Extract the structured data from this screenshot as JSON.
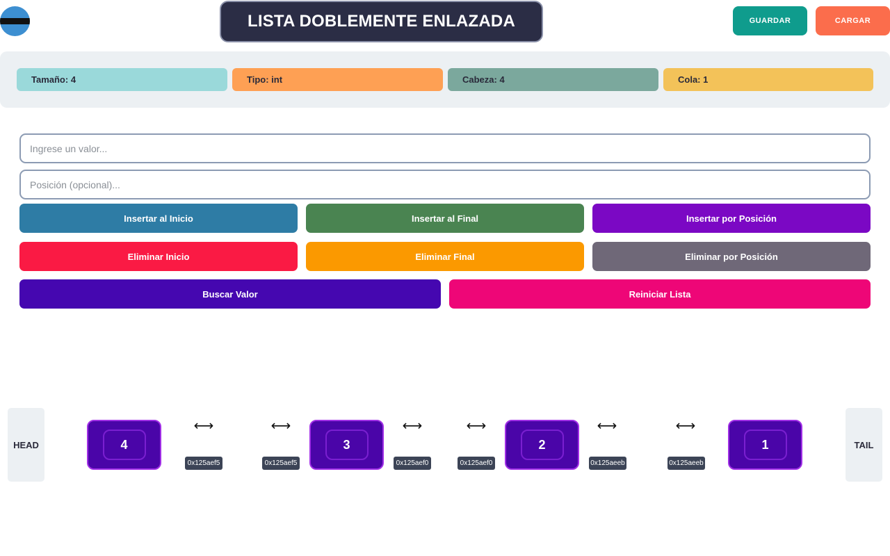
{
  "header": {
    "title": "LISTA DOBLEMENTE ENLAZADA",
    "save_label": "GUARDAR",
    "load_label": "CARGAR"
  },
  "stats": [
    {
      "label": "Tamaño: 4",
      "color": "#9ad9da"
    },
    {
      "label": "Tipo: int",
      "color": "#fea054"
    },
    {
      "label": "Cabeza: 4",
      "color": "#7ba89d"
    },
    {
      "label": "Cola: 1",
      "color": "#f3c259"
    }
  ],
  "inputs": {
    "value_placeholder": "Ingrese un valor...",
    "position_placeholder": "Posición (opcional)..."
  },
  "actions": {
    "insert_start": "Insertar al Inicio",
    "insert_end": "Insertar al Final",
    "insert_position": "Insertar por Posición",
    "delete_start": "Eliminar Inicio",
    "delete_end": "Eliminar Final",
    "delete_position": "Eliminar por Posición",
    "search": "Buscar Valor",
    "reset": "Reiniciar Lista"
  },
  "action_colors": {
    "insert_start": "#2e7ca5",
    "insert_end": "#4a8451",
    "insert_position": "#7b08c4",
    "delete_start": "#fa1a44",
    "delete_end": "#fb9900",
    "delete_position": "#6f6878",
    "search": "#4507b0",
    "reset": "#ee0677"
  },
  "list": {
    "head_label": "HEAD",
    "tail_label": "TAIL",
    "arrow_glyph": "⟷",
    "nodes": [
      "4",
      "3",
      "2",
      "1"
    ],
    "addresses": [
      "0x125aef5",
      "0x125aef5",
      "0x125aef0",
      "0x125aef0",
      "0x125aeeb",
      "0x125aeeb"
    ]
  }
}
